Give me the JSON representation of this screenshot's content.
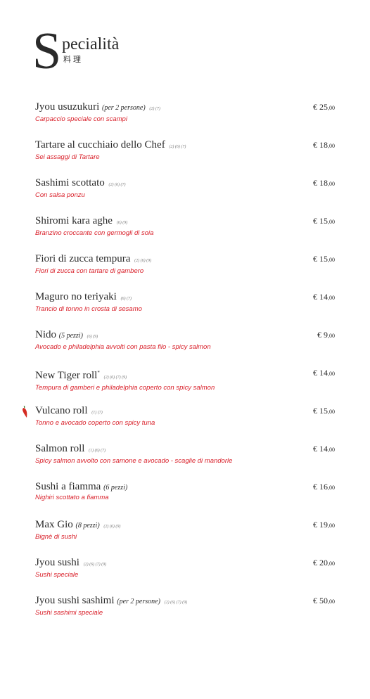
{
  "header": {
    "title_initial": "S",
    "title_rest": "pecialità",
    "title_cjk": "料理"
  },
  "colors": {
    "description": "#d9202a",
    "text": "#2a2a2a",
    "chili": "#d42b22"
  },
  "items": [
    {
      "name": "Jyou usuzukuri",
      "note": "(per 2 persone)",
      "sup": "",
      "allergens": "(2) (7)",
      "description": "Carpaccio speciale con scampi",
      "price_whole": "25",
      "price_cents": ",00",
      "currency": "€",
      "icon": ""
    },
    {
      "name": "Tartare al cucchiaio dello Chef",
      "note": "",
      "sup": "",
      "allergens": "(2) (6) (7)",
      "description": "Sei assaggi di Tartare",
      "price_whole": "18",
      "price_cents": ",00",
      "currency": "€",
      "icon": ""
    },
    {
      "name": "Sashimi scottato",
      "note": "",
      "sup": "",
      "allergens": "(2) (6) (7)",
      "description": "Con salsa ponzu",
      "price_whole": "18",
      "price_cents": ",00",
      "currency": "€",
      "icon": ""
    },
    {
      "name": "Shiromi kara aghe",
      "note": "",
      "sup": "",
      "allergens": "(6) (9)",
      "description": "Branzino croccante con germogli di soia",
      "price_whole": "15",
      "price_cents": ",00",
      "currency": "€",
      "icon": ""
    },
    {
      "name": "Fiori di zucca tempura",
      "note": "",
      "sup": "",
      "allergens": "(2) (6) (9)",
      "description": "Fiori di zucca con tartare di gambero",
      "price_whole": "15",
      "price_cents": ",00",
      "currency": "€",
      "icon": ""
    },
    {
      "name": "Maguro no teriyaki",
      "note": "",
      "sup": "",
      "allergens": "(6) (7)",
      "description": "Trancio di tonno in crosta di sesamo",
      "price_whole": "14",
      "price_cents": ",00",
      "currency": "€",
      "icon": ""
    },
    {
      "name": "Nido",
      "note": "(5 pezzi)",
      "sup": "",
      "allergens": "(6) (9)",
      "description": "Avocado e philadelphia avvolti con pasta filo - spicy salmon",
      "price_whole": "9",
      "price_cents": ",00",
      "currency": "€",
      "icon": ""
    },
    {
      "name": "New Tiger roll",
      "note": "",
      "sup": "*",
      "allergens": "(2) (6) (7) (9)",
      "description": "Tempura di gamberi e philadelphia coperto con spicy salmon",
      "price_whole": "14",
      "price_cents": ",00",
      "currency": "€",
      "icon": ""
    },
    {
      "name": "Vulcano roll",
      "note": "",
      "sup": "",
      "allergens": "(1) (7)",
      "description": "Tonno e avocado coperto con spicy tuna",
      "price_whole": "15",
      "price_cents": ",00",
      "currency": "€",
      "icon": "chili-pepper-icon"
    },
    {
      "name": "Salmon roll",
      "note": "",
      "sup": "",
      "allergens": "(1) (6) (7)",
      "description": "Spicy salmon avvolto con samone e avocado - scaglie di mandorle",
      "price_whole": "14",
      "price_cents": ",00",
      "currency": "€",
      "icon": ""
    },
    {
      "name": "Sushi a fiamma",
      "note": "(6 pezzi)",
      "sup": "",
      "allergens": "",
      "description": "Nighiri scottato a fiamma",
      "price_whole": "16",
      "price_cents": ",00",
      "currency": "€",
      "icon": ""
    },
    {
      "name": "Max Gio",
      "note": "(8 pezzi)",
      "sup": "",
      "allergens": "(2) (6) (9)",
      "description": "Bignè di sushi",
      "price_whole": "19",
      "price_cents": ",00",
      "currency": "€",
      "icon": ""
    },
    {
      "name": "Jyou sushi",
      "note": "",
      "sup": "",
      "allergens": "(2) (6) (7) (9)",
      "description": "Sushi speciale",
      "price_whole": "20",
      "price_cents": ",00",
      "currency": "€",
      "icon": ""
    },
    {
      "name": "Jyou sushi sashimi",
      "note": "(per 2 persone)",
      "sup": "",
      "allergens": "(2) (6) (7) (9)",
      "description": "Sushi sashimi speciale",
      "price_whole": "50",
      "price_cents": ",00",
      "currency": "€",
      "icon": ""
    }
  ]
}
